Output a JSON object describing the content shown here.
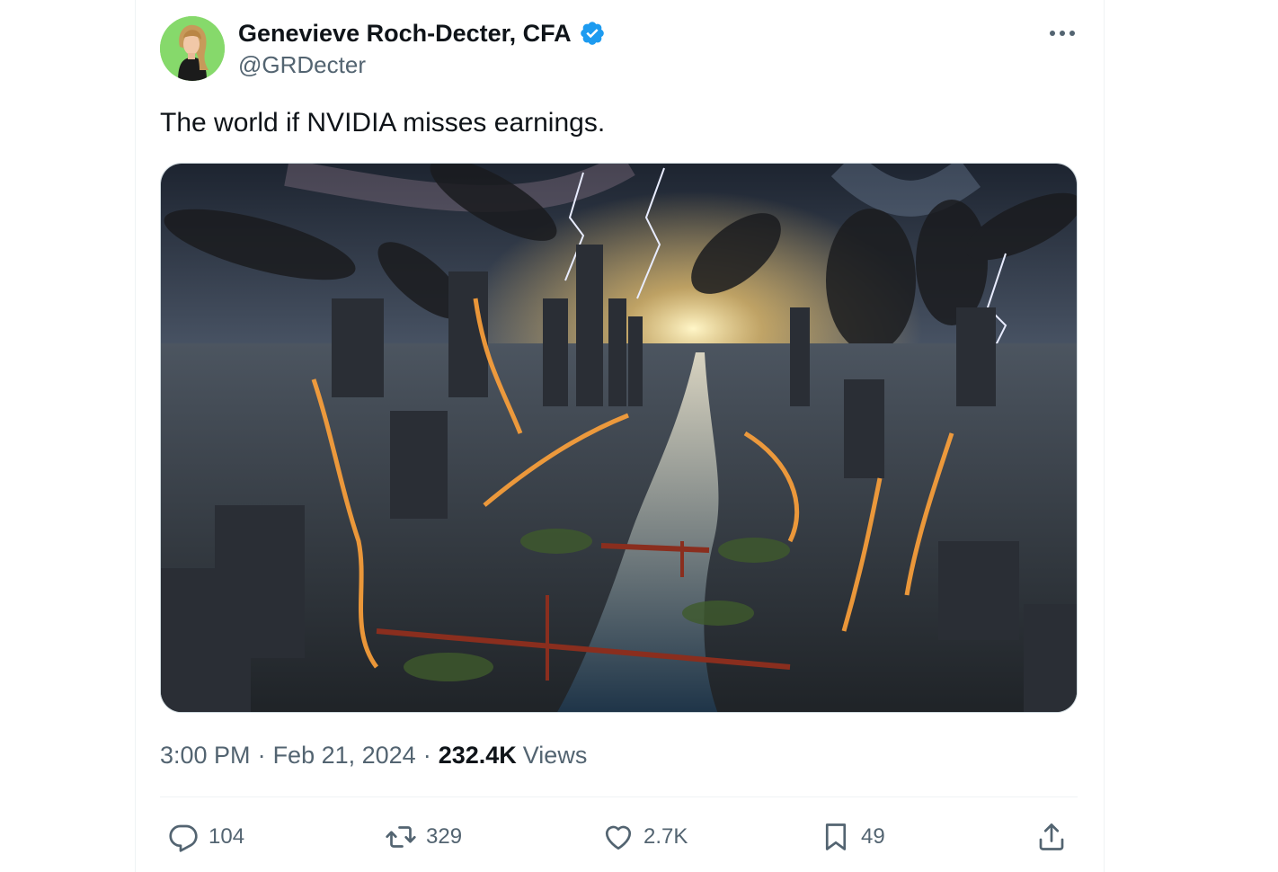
{
  "tweet": {
    "author": {
      "display_name": "Genevieve Roch-Decter, CFA",
      "handle": "@GRDecter",
      "verified": true,
      "verified_color": "#1d9bf0"
    },
    "text": "The world if NVIDIA misses earnings.",
    "media": {
      "type": "image",
      "subject": "apocalyptic city"
    },
    "meta": {
      "time": "3:00 PM",
      "date": "Feb 21, 2024",
      "separator": "·",
      "views_count": "232.4K",
      "views_label": "Views"
    },
    "actions": {
      "reply": {
        "icon": "reply-icon",
        "count": "104"
      },
      "retweet": {
        "icon": "retweet-icon",
        "count": "329"
      },
      "like": {
        "icon": "heart-icon",
        "count": "2.7K"
      },
      "bookmark": {
        "icon": "bookmark-icon",
        "count": "49"
      },
      "share": {
        "icon": "share-icon"
      }
    },
    "more_icon": "more-dots-icon"
  },
  "colors": {
    "text_primary": "#0f1419",
    "text_secondary": "#536471",
    "divider": "#eff3f4"
  }
}
